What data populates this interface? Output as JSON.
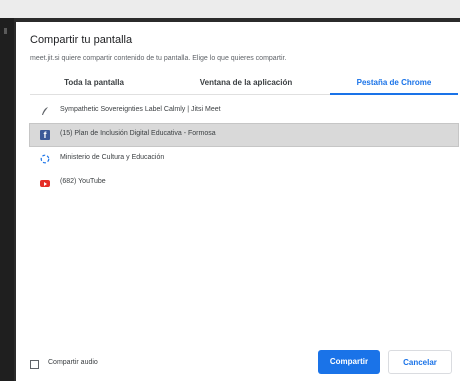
{
  "dialog": {
    "title": "Compartir tu pantalla",
    "subtitle": "meet.jit.si quiere compartir contenido de tu pantalla. Elige lo que quieres compartir."
  },
  "tabs": [
    {
      "label": "Toda la pantalla",
      "active": false
    },
    {
      "label": "Ventana de la aplicación",
      "active": false
    },
    {
      "label": "Pestaña de Chrome",
      "active": true
    }
  ],
  "items": [
    {
      "label": "Sympathetic Sovereignties Label Calmly | Jitsi Meet",
      "icon": "jitsi-feather-icon",
      "selected": false
    },
    {
      "label": "(15) Plan de Inclusión Digital Educativa - Formosa",
      "icon": "facebook-icon",
      "selected": true
    },
    {
      "label": "Ministerio de Cultura y Educación",
      "icon": "loading-icon",
      "selected": false
    },
    {
      "label": "(682) YouTube",
      "icon": "youtube-icon",
      "selected": false
    }
  ],
  "footer": {
    "audio_label": "Compartir audio",
    "audio_checked": false,
    "share_button": "Compartir",
    "cancel_button": "Cancelar"
  },
  "colors": {
    "accent": "#1a73e8",
    "selected_row": "#d9d9d9",
    "facebook": "#3b5998",
    "youtube": "#e52d27"
  }
}
